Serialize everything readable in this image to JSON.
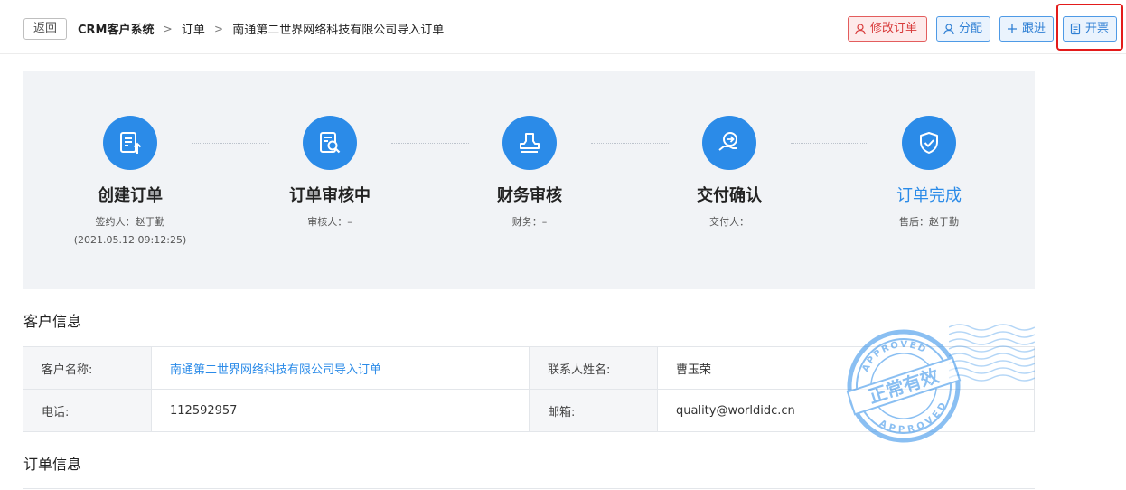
{
  "header": {
    "back_label": "返回",
    "breadcrumb": [
      "CRM客户系统",
      "订单",
      "南通第二世界网络科技有限公司导入订单"
    ],
    "buttons": {
      "edit_order": "修改订单",
      "assign": "分配",
      "follow_up": "跟进",
      "invoice": "开票"
    }
  },
  "colors": {
    "accent": "#2b8be8",
    "danger": "#d83a3a",
    "highlight": "#e31b1b"
  },
  "steps": [
    {
      "title": "创建订单",
      "line1": "签约人：赵于勤",
      "line2": "(2021.05.12 09:12:25)",
      "icon": "create-order-icon"
    },
    {
      "title": "订单审核中",
      "line1": "审核人：–",
      "line2": "",
      "icon": "review-icon"
    },
    {
      "title": "财务审核",
      "line1": "财务：–",
      "line2": "",
      "icon": "finance-stamp-icon"
    },
    {
      "title": "交付确认",
      "line1": "交付人：",
      "line2": "",
      "icon": "delivery-icon"
    },
    {
      "title": "订单完成",
      "line1": "售后：赵于勤",
      "line2": "",
      "icon": "shield-check-icon"
    }
  ],
  "customer": {
    "section_title": "客户信息",
    "rows": [
      {
        "label1": "客户名称:",
        "value1": "南通第二世界网络科技有限公司导入订单",
        "label2": "联系人姓名:",
        "value2": "曹玉荣"
      },
      {
        "label1": "电话:",
        "value1": "112592957",
        "label2": "邮箱:",
        "value2": "quality@worldidc.cn"
      }
    ]
  },
  "stamp": {
    "main_text": "正常有效",
    "ring_text": "APPROVED"
  },
  "order": {
    "section_title": "订单信息"
  }
}
